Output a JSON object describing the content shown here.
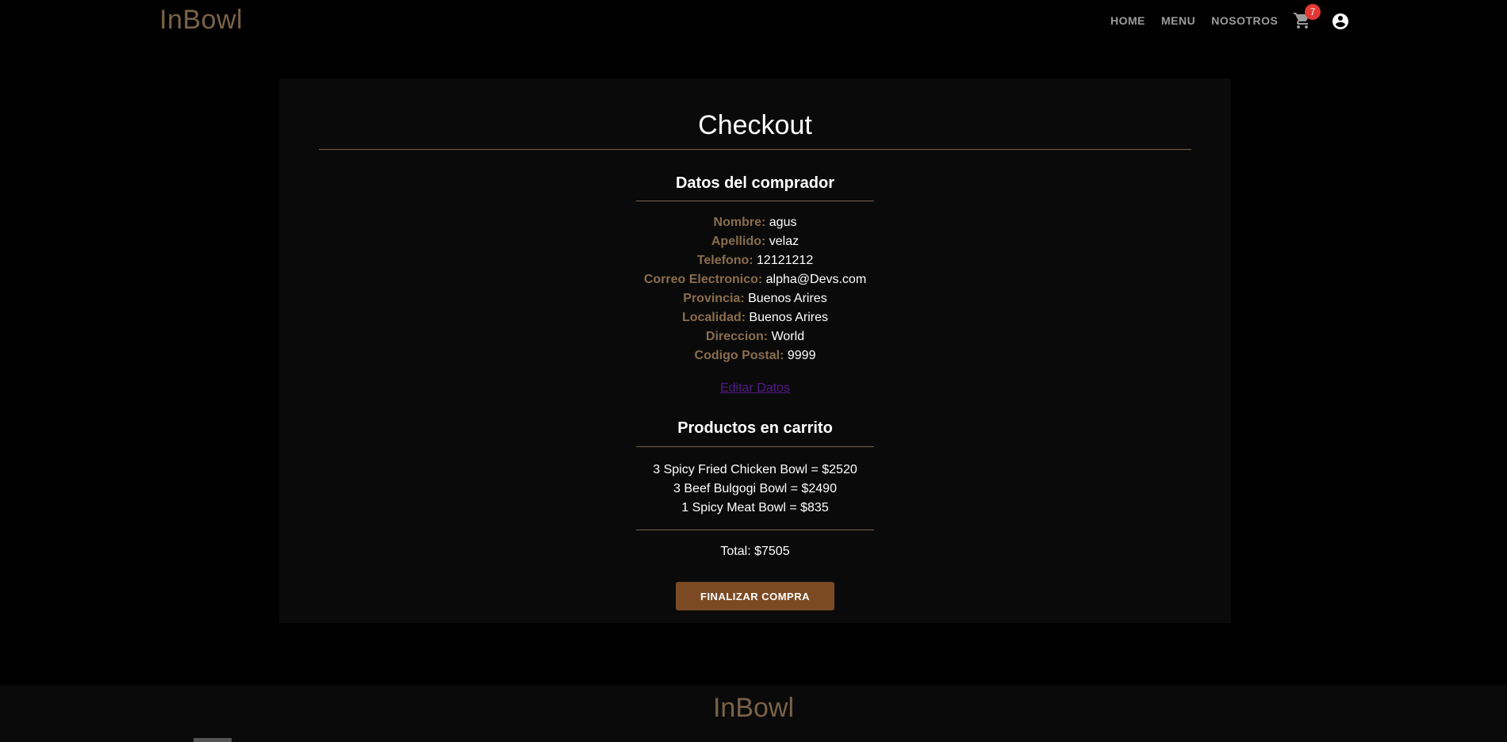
{
  "navbar": {
    "brand": "InBowl",
    "links": [
      "HOME",
      "MENU",
      "NOSOTROS"
    ],
    "cart_count": "7"
  },
  "checkout": {
    "title": "Checkout",
    "buyer_section_title": "Datos del comprador",
    "fields": [
      {
        "label": "Nombre:",
        "value": "agus"
      },
      {
        "label": "Apellido:",
        "value": "velaz"
      },
      {
        "label": "Telefono:",
        "value": "12121212"
      },
      {
        "label": "Correo Electronico:",
        "value": "alpha@Devs.com"
      },
      {
        "label": "Provincia:",
        "value": "Buenos Arires"
      },
      {
        "label": "Localidad:",
        "value": "Buenos Arires"
      },
      {
        "label": "Direccion:",
        "value": "World"
      },
      {
        "label": "Codigo Postal:",
        "value": "9999"
      }
    ],
    "edit_link": "Editar Datos",
    "products_section_title": "Productos en carrito",
    "products": [
      "3 Spicy Fried Chicken Bowl = $2520",
      "3 Beef Bulgogi Bowl = $2490",
      "1 Spicy Meat Bowl = $835"
    ],
    "total": "Total: $7505",
    "finalize_button": "FINALIZAR COMPRA"
  },
  "footer": {
    "brand": "InBowl"
  },
  "colors": {
    "accent": "#7a6248",
    "button": "#7b4a24",
    "badge": "#e53935",
    "link": "#551a8b"
  },
  "icons": {
    "cart": "shopping-cart-icon",
    "account": "account-circle-icon"
  }
}
